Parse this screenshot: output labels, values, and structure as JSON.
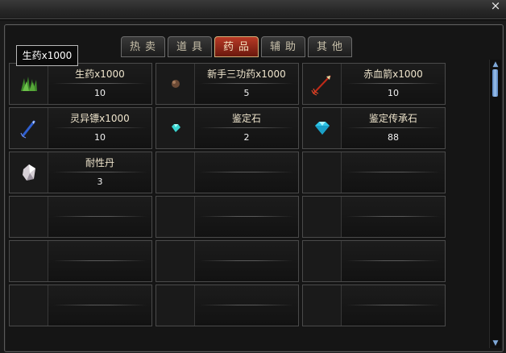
{
  "window": {
    "close_label": "×"
  },
  "tabs": [
    {
      "label": "热卖"
    },
    {
      "label": "道具"
    },
    {
      "label": "药品",
      "active": true
    },
    {
      "label": "辅助"
    },
    {
      "label": "其他"
    }
  ],
  "tooltip": {
    "text": "生药x1000"
  },
  "slots": [
    {
      "name": "生药x1000",
      "qty": "10",
      "icon": "herb-icon"
    },
    {
      "name": "新手三功药x1000",
      "qty": "5",
      "icon": "pill-icon"
    },
    {
      "name": "赤血箭x1000",
      "qty": "10",
      "icon": "red-arrow-icon"
    },
    {
      "name": "灵异镖x1000",
      "qty": "10",
      "icon": "dart-icon"
    },
    {
      "name": "鉴定石",
      "qty": "2",
      "icon": "small-gem-icon"
    },
    {
      "name": "鉴定传承石",
      "qty": "88",
      "icon": "gem-icon"
    },
    {
      "name": "耐性丹",
      "qty": "3",
      "icon": "crystal-icon"
    },
    {
      "name": "",
      "qty": ""
    },
    {
      "name": "",
      "qty": ""
    },
    {
      "name": "",
      "qty": ""
    },
    {
      "name": "",
      "qty": ""
    },
    {
      "name": "",
      "qty": ""
    },
    {
      "name": "",
      "qty": ""
    },
    {
      "name": "",
      "qty": ""
    },
    {
      "name": "",
      "qty": ""
    },
    {
      "name": "",
      "qty": ""
    },
    {
      "name": "",
      "qty": ""
    },
    {
      "name": "",
      "qty": ""
    }
  ],
  "scrollbar": {
    "up_icon": "scroll-up-icon",
    "down_icon": "scroll-down-icon"
  }
}
